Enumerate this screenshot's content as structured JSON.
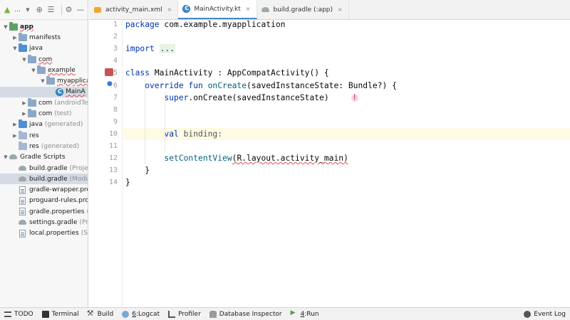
{
  "project_panel": {
    "title": "...",
    "tree": [
      {
        "label": "app",
        "sub": "",
        "icon": "folder-app",
        "arrow": "down",
        "indent": 0,
        "bold": true,
        "underline": true
      },
      {
        "label": "manifests",
        "sub": "",
        "icon": "folder",
        "arrow": "right",
        "indent": 1
      },
      {
        "label": "java",
        "sub": "",
        "icon": "folder-java",
        "arrow": "down",
        "indent": 1
      },
      {
        "label": "com",
        "sub": "",
        "icon": "folder",
        "arrow": "down",
        "indent": 2,
        "underline": true
      },
      {
        "label": "example",
        "sub": "",
        "icon": "folder",
        "arrow": "down",
        "indent": 3,
        "underline": true
      },
      {
        "label": "myapplica",
        "sub": "",
        "icon": "folder",
        "arrow": "down",
        "indent": 4,
        "underline": true
      },
      {
        "label": "MainA",
        "sub": "",
        "icon": "kt",
        "arrow": "none",
        "indent": 5,
        "selected": true,
        "underline": true
      },
      {
        "label": "com",
        "sub": "(androidTest)",
        "icon": "folder",
        "arrow": "right",
        "indent": 2
      },
      {
        "label": "com",
        "sub": "(test)",
        "icon": "folder",
        "arrow": "right",
        "indent": 2
      },
      {
        "label": "java",
        "sub": "(generated)",
        "icon": "folder-java",
        "arrow": "right",
        "indent": 1
      },
      {
        "label": "res",
        "sub": "",
        "icon": "folder-res",
        "arrow": "right",
        "indent": 1
      },
      {
        "label": "res",
        "sub": "(generated)",
        "icon": "folder-res",
        "arrow": "none",
        "indent": 1
      },
      {
        "label": "Gradle Scripts",
        "sub": "",
        "icon": "gradle",
        "arrow": "down",
        "indent": 0
      },
      {
        "label": "build.gradle",
        "sub": "(Project:",
        "icon": "gradle",
        "arrow": "none",
        "indent": 1
      },
      {
        "label": "build.gradle",
        "sub": "(Module",
        "icon": "gradle",
        "arrow": "none",
        "indent": 1,
        "selected": true
      },
      {
        "label": "gradle-wrapper.prop",
        "sub": "",
        "icon": "file",
        "arrow": "none",
        "indent": 1
      },
      {
        "label": "proguard-rules.pro",
        "sub": "(F",
        "icon": "file",
        "arrow": "none",
        "indent": 1
      },
      {
        "label": "gradle.properties",
        "sub": "(Proj",
        "icon": "file",
        "arrow": "none",
        "indent": 1
      },
      {
        "label": "settings.gradle",
        "sub": "(Proje",
        "icon": "gradle",
        "arrow": "none",
        "indent": 1
      },
      {
        "label": "local.properties",
        "sub": "(SDK",
        "icon": "file",
        "arrow": "none",
        "indent": 1
      }
    ]
  },
  "editor_tabs": [
    {
      "label": "activity_main.xml",
      "icon": "xml",
      "active": false
    },
    {
      "label": "MainActivity.kt",
      "icon": "kt",
      "active": true
    },
    {
      "label": "build.gradle (:app)",
      "icon": "gradle",
      "active": false
    }
  ],
  "editor": {
    "line_numbers": [
      "1",
      "2",
      "3",
      "4",
      "5",
      "6",
      "7",
      "8",
      "9",
      "10",
      "11",
      "12",
      "13",
      "14"
    ],
    "current_line": 10,
    "lines": [
      [
        {
          "t": "package ",
          "c": "kw"
        },
        {
          "t": "com.example.myapplication",
          "c": ""
        }
      ],
      [],
      [
        {
          "t": "import ",
          "c": "kw"
        },
        {
          "t": "...",
          "c": "collapsed"
        }
      ],
      [],
      [
        {
          "t": "class ",
          "c": "kw"
        },
        {
          "t": "MainActivity : AppCompatActivity() {",
          "c": ""
        }
      ],
      [
        {
          "t": "    override fun ",
          "c": "kw"
        },
        {
          "t": "onCreate",
          "c": "fn"
        },
        {
          "t": "(savedInstanceState: Bundle?) {",
          "c": ""
        }
      ],
      [
        {
          "t": "        super",
          "c": "kw"
        },
        {
          "t": ".onCreate(savedInstanceState)",
          "c": ""
        }
      ],
      [],
      [],
      [
        {
          "t": "        val ",
          "c": "kw"
        },
        {
          "t": "binding:",
          "c": "gray-var"
        }
      ],
      [],
      [
        {
          "t": "        setContentView",
          "c": "fn"
        },
        {
          "t": "(R.layout.activity_main)",
          "c": "err"
        }
      ],
      [
        {
          "t": "    }",
          "c": ""
        }
      ],
      [
        {
          "t": "}",
          "c": ""
        }
      ]
    ]
  },
  "bottom_bar": {
    "items": [
      {
        "label": "TODO",
        "icon": "todo",
        "mnemonic": ""
      },
      {
        "label": "Terminal",
        "icon": "terminal",
        "mnemonic": ""
      },
      {
        "label": "Build",
        "icon": "build",
        "mnemonic": ""
      },
      {
        "label": "Logcat",
        "icon": "logcat",
        "mnemonic": "6"
      },
      {
        "label": "Profiler",
        "icon": "profiler",
        "mnemonic": ""
      },
      {
        "label": "Database Inspector",
        "icon": "db",
        "mnemonic": ""
      },
      {
        "label": "Run",
        "icon": "run",
        "mnemonic": "4"
      }
    ],
    "right_item": {
      "label": "Event Log",
      "icon": "event"
    }
  }
}
